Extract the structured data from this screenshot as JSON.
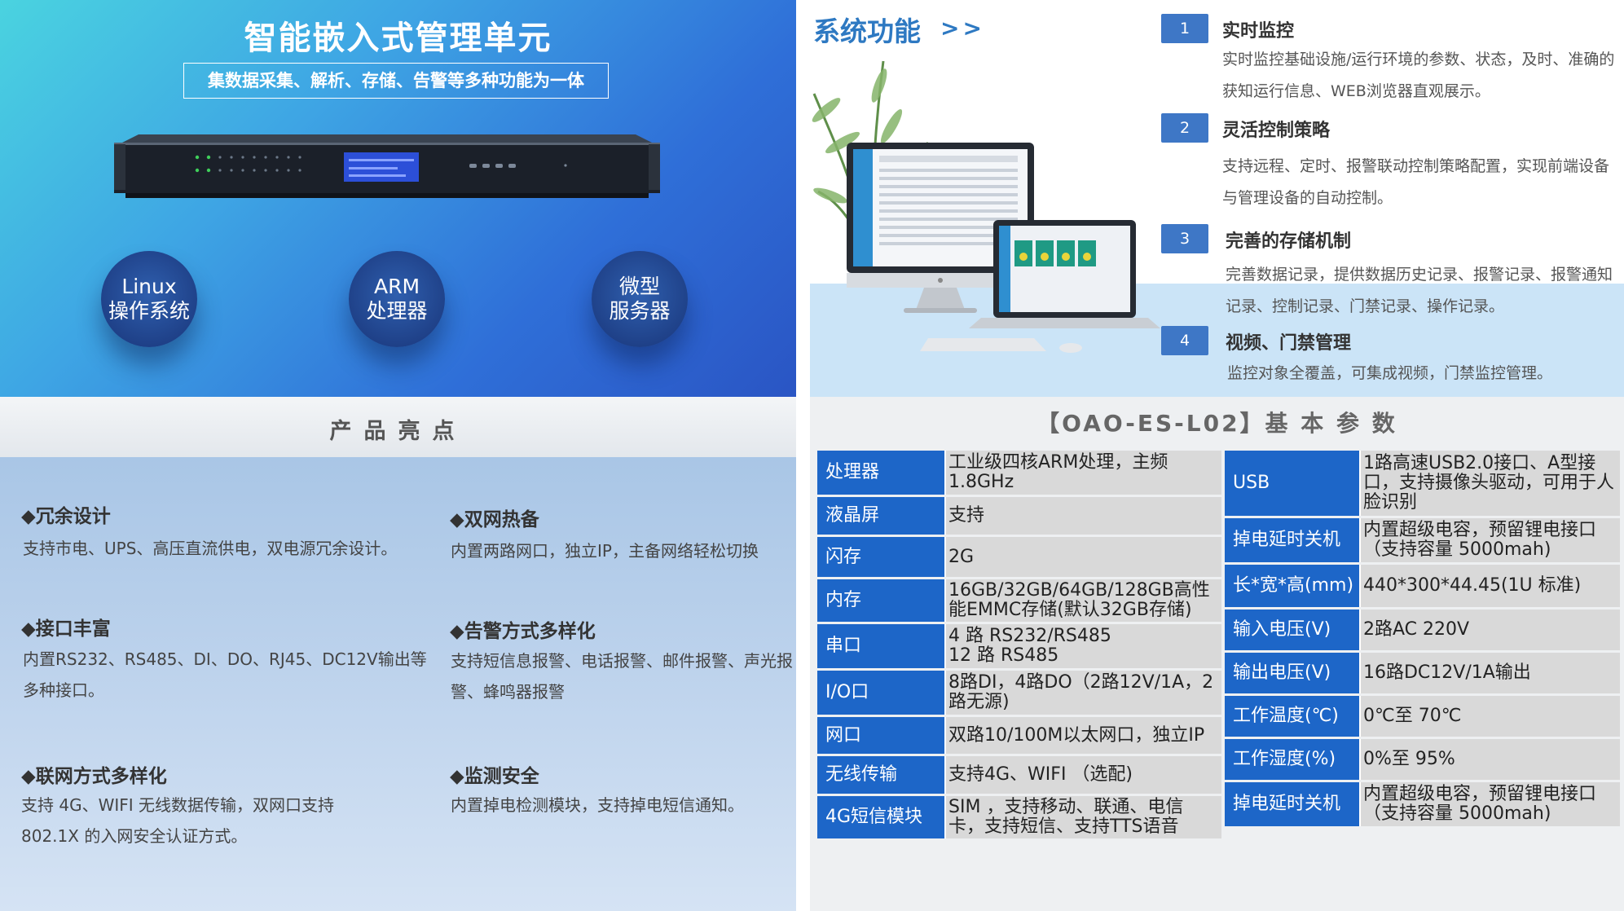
{
  "hero": {
    "title": "智能嵌入式管理单元",
    "subtitle": "集数据采集、解析、存储、告警等多种功能为一体",
    "circles": [
      {
        "line1": "Linux",
        "line2": "操作系统"
      },
      {
        "line1": "ARM",
        "line2": "处理器"
      },
      {
        "line1": "微型",
        "line2": "服务器"
      }
    ]
  },
  "system_functions": {
    "title": "系统功能",
    "arrow": ">>",
    "items": [
      {
        "num": "1",
        "title": "实时监控",
        "desc": "实时监控基础设施/运行环境的参数、状态，及时、准确的获知运行信息、WEB浏览器直观展示。"
      },
      {
        "num": "2",
        "title": "灵活控制策略",
        "desc": "支持远程、定时、报警联动控制策略配置，实现前端设备与管理设备的自动控制。"
      },
      {
        "num": "3",
        "title": "完善的存储机制",
        "desc": "完善数据记录，提供数据历史记录、报警记录、报警通知记录、控制记录、门禁记录、操作记录。"
      },
      {
        "num": "4",
        "title": "视频、门禁管理",
        "desc": "监控对象全覆盖，可集成视频，门禁监控管理。"
      }
    ]
  },
  "highlights": {
    "title": "产品亮点",
    "items": [
      {
        "title": "◆冗余设计",
        "desc": "支持市电、UPS、高压直流供电，双电源冗余设计。"
      },
      {
        "title": "◆双网热备",
        "desc": "内置两路网口，独立IP，主备网络轻松切换"
      },
      {
        "title": "◆接口丰富",
        "desc": "内置RS232、RS485、DI、DO、RJ45、DC12V输出等多种接口。"
      },
      {
        "title": "◆告警方式多样化",
        "desc": "支持短信息报警、电话报警、邮件报警、声光报警、蜂鸣器报警"
      },
      {
        "title": "◆联网方式多样化",
        "desc": "支持 4G、WIFI 无线数据传输，双网口支持 802.1X 的入网安全认证方式。"
      },
      {
        "title": "◆监测安全",
        "desc": "内置掉电检测模块，支持掉电短信通知。"
      }
    ]
  },
  "params": {
    "title": "【OAO-ES-L02】基 本 参 数",
    "left": [
      {
        "key": "处理器",
        "value": "工业级四核ARM处理，主频1.8GHz"
      },
      {
        "key": "液晶屏",
        "value": "支持"
      },
      {
        "key": "闪存",
        "value": "2G"
      },
      {
        "key": "内存",
        "value": "16GB/32GB/64GB/128GB高性能EMMC存储(默认32GB存储)"
      },
      {
        "key": "串口",
        "value": "4 路 RS232/RS485\n12 路 RS485"
      },
      {
        "key": "I/O口",
        "value": "8路DI，4路DO（2路12V/1A，2路无源)"
      },
      {
        "key": "网口",
        "value": "双路10/100M以太网口，独立IP"
      },
      {
        "key": "无线传输",
        "value": "支持4G、WIFI （选配)"
      },
      {
        "key": "4G短信模块",
        "value": "SIM ，支持移动、联通、电信卡，支持短信、支持TTS语音"
      }
    ],
    "right": [
      {
        "key": "USB",
        "value": "1路高速USB2.0接口、A型接口，支持摄像头驱动，可用于人脸识别"
      },
      {
        "key": "掉电延时关机",
        "value": "内置超级电容，预留锂电接口（支持容量 5000mah)"
      },
      {
        "key": "长*宽*高(mm)",
        "value": "440*300*44.45(1U 标准)"
      },
      {
        "key": "输入电压(V)",
        "value": "2路AC 220V"
      },
      {
        "key": "输出电压(V)",
        "value": "16路DC12V/1A输出"
      },
      {
        "key": "工作温度(℃)",
        "value": "0℃至 70℃"
      },
      {
        "key": "工作湿度(%)",
        "value": "0%至 95%"
      },
      {
        "key": "掉电延时关机",
        "value": "内置超级电容，预留锂电接口（支持容量 5000mah)"
      }
    ]
  },
  "colors": {
    "table_key_bg": "#1d66c8",
    "table_value_bg": "#d9d9d9",
    "accent_blue": "#2e79c2",
    "feature_number_bg": "#3e77c6"
  }
}
